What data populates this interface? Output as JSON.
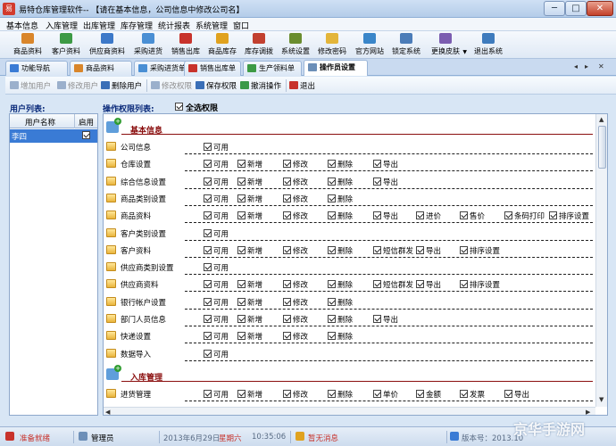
{
  "window": {
    "title": "易特仓库管理软件-- 【请在基本信息，公司信息中修改公司名】",
    "app_icon_text": "易",
    "min": "─",
    "max": "□",
    "close": "✕"
  },
  "menu": [
    "基本信息",
    "入库管理",
    "出库管理",
    "库存管理",
    "统计报表",
    "系统管理",
    "窗口"
  ],
  "toolbar": [
    {
      "label": "商品资料",
      "icon": "goods-icon",
      "color": "#d9862b"
    },
    {
      "label": "客户资料",
      "icon": "customer-icon",
      "color": "#3d9a45"
    },
    {
      "label": "供应商资料",
      "icon": "supplier-icon",
      "color": "#3c78c8"
    },
    {
      "label": "采购进货",
      "icon": "purchase-icon",
      "color": "#4a8fd4"
    },
    {
      "label": "销售出库",
      "icon": "sales-out-icon",
      "color": "#c8332c"
    },
    {
      "label": "商品库存",
      "icon": "stock-icon",
      "color": "#e0a21f"
    },
    {
      "label": "库存调拨",
      "icon": "transfer-icon",
      "color": "#c2402f"
    },
    {
      "label": "系统设置",
      "icon": "settings-icon",
      "color": "#6a8d2f"
    },
    {
      "label": "修改密码",
      "icon": "password-icon",
      "color": "#e3b53a"
    },
    {
      "label": "官方网站",
      "icon": "website-icon",
      "color": "#3a86c9"
    },
    {
      "label": "锁定系统",
      "icon": "lock-icon",
      "color": "#4b7cb8"
    },
    {
      "label": "更换皮肤",
      "icon": "skin-icon",
      "color": "#7b5db0"
    },
    {
      "label": "退出系统",
      "icon": "exit-icon",
      "color": "#3e7bbd"
    }
  ],
  "tabs": [
    {
      "label": "功能导航",
      "color": "#3a7bd5"
    },
    {
      "label": "商品资料",
      "color": "#d9862b"
    },
    {
      "label": "采购进货单",
      "color": "#4a8fd4"
    },
    {
      "label": "销售出库单",
      "color": "#c8332c"
    },
    {
      "label": "生产领料单",
      "color": "#3d9a45"
    },
    {
      "label": "操作员设置",
      "color": "#6c8fb8"
    }
  ],
  "tab_nav": [
    "◂",
    "▸",
    "✕"
  ],
  "actions": [
    {
      "label": "增加用户",
      "disabled": true,
      "color": "#9bb0cc"
    },
    {
      "label": "修改用户",
      "disabled": true,
      "color": "#9bb0cc"
    },
    {
      "label": "删除用户",
      "disabled": false,
      "color": "#3a6fb7"
    },
    {
      "label": "修改权限",
      "disabled": true,
      "color": "#9bb0cc"
    },
    {
      "label": "保存权限",
      "disabled": false,
      "color": "#3a6fb7"
    },
    {
      "label": "撤消操作",
      "disabled": false,
      "color": "#3a9a48"
    },
    {
      "label": "退出",
      "disabled": false,
      "color": "#c8332c"
    }
  ],
  "user_list": {
    "title": "用户列表:",
    "col_name": "用户名称",
    "col_enabled": "启用",
    "row_name": "李四"
  },
  "perm_list": {
    "title": "操作权限列表:",
    "select_all": "全选权限"
  },
  "sections": [
    {
      "title": "基本信息",
      "rows": [
        {
          "name": "公司信息",
          "opts": [
            "可用"
          ]
        },
        {
          "name": "仓库设置",
          "opts": [
            "可用",
            "新增",
            "修改",
            "删除",
            "导出"
          ]
        },
        {
          "name": "综合信息设置",
          "opts": [
            "可用",
            "新增",
            "修改",
            "删除",
            "导出"
          ]
        },
        {
          "name": "商品类别设置",
          "opts": [
            "可用",
            "新增",
            "修改",
            "删除"
          ]
        },
        {
          "name": "商品资料",
          "opts": [
            "可用",
            "新增",
            "修改",
            "删除",
            "导出",
            "进价",
            "售价",
            "条码打印",
            "排序设置"
          ]
        },
        {
          "name": "客户类别设置",
          "opts": [
            "可用"
          ]
        },
        {
          "name": "客户资料",
          "opts": [
            "可用",
            "新增",
            "修改",
            "删除",
            "短信群发",
            "导出",
            "排序设置"
          ]
        },
        {
          "name": "供应商类别设置",
          "opts": [
            "可用"
          ]
        },
        {
          "name": "供应商资料",
          "opts": [
            "可用",
            "新增",
            "修改",
            "删除",
            "短信群发",
            "导出",
            "排序设置"
          ]
        },
        {
          "name": "银行帐户设置",
          "opts": [
            "可用",
            "新增",
            "修改",
            "删除"
          ]
        },
        {
          "name": "部门人员信息",
          "opts": [
            "可用",
            "新增",
            "修改",
            "删除",
            "导出"
          ]
        },
        {
          "name": "快递设置",
          "opts": [
            "可用",
            "新增",
            "修改",
            "删除"
          ]
        },
        {
          "name": "数据导入",
          "opts": [
            "可用"
          ]
        }
      ]
    },
    {
      "title": "入库管理",
      "rows": [
        {
          "name": "进货管理",
          "opts": [
            "可用",
            "新增",
            "修改",
            "删除",
            "单价",
            "金额",
            "发票",
            "导出"
          ]
        }
      ]
    }
  ],
  "scroll": {
    "up": "▲",
    "down": "▼",
    "left": "◀",
    "right": "▶"
  },
  "status": {
    "ready": "准备就绪",
    "operator": "管理员",
    "date": "2013年6月29日",
    "weekday": "星期六",
    "time": "10:35:06",
    "message": "暂无消息",
    "version": "版本号：2013.10"
  },
  "watermark": "京华手游网",
  "colors": {
    "accent": "#3a7bd5",
    "section_title": "#8a0e0e",
    "ready": "#c8332c"
  }
}
